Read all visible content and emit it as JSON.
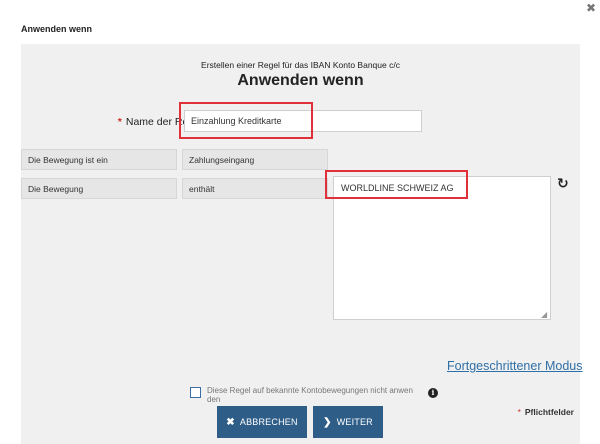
{
  "dialog": {
    "title": "Anwenden wenn",
    "close_icon": "close-icon"
  },
  "panel": {
    "subtitle": "Erstellen einer Regel für das IBAN Konto Banque c/c",
    "heading": "Anwenden wenn"
  },
  "name_field": {
    "required_mark": "*",
    "label": "Name der Rege",
    "value": "Einzahlung Kreditkarte"
  },
  "rows": [
    {
      "label": "Die Bewegung ist ein",
      "value": "Zahlungseingang"
    },
    {
      "label": "Die Bewegung",
      "operator": "enthält"
    }
  ],
  "match_text": "WORLDLINE SCHWEIZ AG",
  "reset_icon": "undo-icon",
  "advanced_link": "Fortgeschrittener Modus",
  "checkbox": {
    "label": "Diese Regel auf bekannte Kontobewegungen nicht anwen den",
    "checked": false
  },
  "required_note": {
    "mark": "*",
    "text": "Pflichtfelder"
  },
  "buttons": {
    "cancel": "ABBRECHEN",
    "next": "WEITER"
  },
  "colors": {
    "primary_button": "#2e5e88",
    "link": "#2f6fa7",
    "required": "#c9302c",
    "highlight": "#e0313a"
  }
}
